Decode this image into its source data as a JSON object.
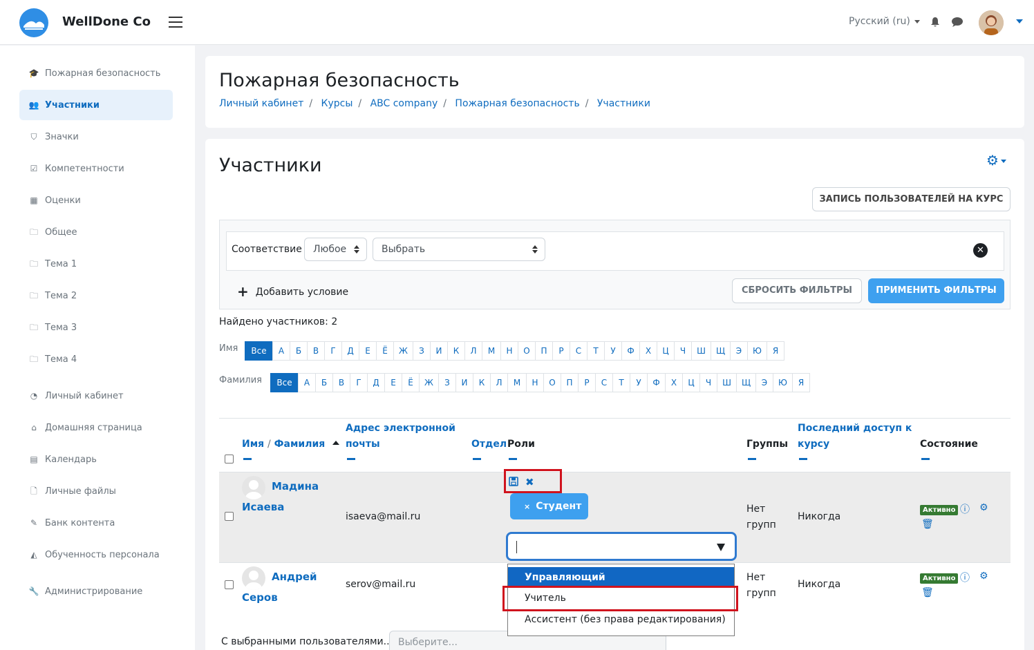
{
  "header": {
    "brand": "WellDone Co",
    "language": "Русский ‎(ru)‎"
  },
  "sidebar": {
    "items": [
      {
        "label": "Пожарная безопасность",
        "icon": "graduation-cap-icon"
      },
      {
        "label": "Участники",
        "icon": "users-icon",
        "active": true
      },
      {
        "label": "Значки",
        "icon": "shield-icon"
      },
      {
        "label": "Компетентности",
        "icon": "check-square-icon"
      },
      {
        "label": "Оценки",
        "icon": "table-icon"
      },
      {
        "label": "Общее",
        "icon": "folder-icon"
      },
      {
        "label": "Тема 1",
        "icon": "folder-icon"
      },
      {
        "label": "Тема 2",
        "icon": "folder-icon"
      },
      {
        "label": "Тема 3",
        "icon": "folder-icon"
      },
      {
        "label": "Тема 4",
        "icon": "folder-icon"
      },
      {
        "label": "Личный кабинет",
        "icon": "dashboard-icon"
      },
      {
        "label": "Домашняя страница",
        "icon": "home-icon"
      },
      {
        "label": "Календарь",
        "icon": "calendar-icon"
      },
      {
        "label": "Личные файлы",
        "icon": "file-icon"
      },
      {
        "label": "Банк контента",
        "icon": "brush-icon"
      },
      {
        "label": "Обученность персонала",
        "icon": "area-chart-icon"
      },
      {
        "label": "Администрирование",
        "icon": "wrench-icon"
      }
    ]
  },
  "page": {
    "heading": "Пожарная безопасность",
    "breadcrumb": [
      "Личный кабинет",
      "Курсы",
      "ABC company",
      "Пожарная безопасность",
      "Участники"
    ]
  },
  "participants": {
    "title": "Участники",
    "enrol_button": "ЗАПИСЬ ПОЛЬЗОВАТЕЛЕЙ НА КУРС",
    "filter": {
      "match_label": "Соответствие",
      "match_value": "Любое",
      "type_value": "Выбрать",
      "add_condition": "Добавить условие",
      "reset": "СБРОСИТЬ ФИЛЬТРЫ",
      "apply": "ПРИМЕНИТЬ ФИЛЬТРЫ"
    },
    "found": "Найдено участников: 2",
    "firstname_label": "Имя",
    "lastname_label": "Фамилия",
    "all_label": "Все",
    "letters": [
      "А",
      "Б",
      "В",
      "Г",
      "Д",
      "Е",
      "Ё",
      "Ж",
      "З",
      "И",
      "К",
      "Л",
      "М",
      "Н",
      "О",
      "П",
      "Р",
      "С",
      "Т",
      "У",
      "Ф",
      "Х",
      "Ц",
      "Ч",
      "Ш",
      "Щ",
      "Э",
      "Ю",
      "Я"
    ],
    "columns": {
      "name_first": "Имя",
      "name_sep": "/",
      "name_last": "Фамилия",
      "email_line1": "Адрес электронной",
      "email_line2": "почты",
      "dept": "Отдел",
      "roles": "Роли",
      "groups": "Группы",
      "access_line1": "Последний доступ к",
      "access_line2": "курсу",
      "status": "Состояние"
    },
    "rows": [
      {
        "first": "Мадина",
        "last": "Исаева",
        "email": "isaeva@mail.ru",
        "groups_line1": "Нет",
        "groups_line2": "групп",
        "access": "Никогда",
        "status": "Активно"
      },
      {
        "first": "Андрей",
        "last": "Серов",
        "email": "serov@mail.ru",
        "groups_line1": "Нет",
        "groups_line2": "групп",
        "access": "Никогда",
        "status": "Активно"
      }
    ],
    "role_edit": {
      "current_role": "Студент",
      "options": [
        "Управляющий",
        "Учитель",
        "Ассистент (без права редактирования)"
      ],
      "highlight_color": "#d0131d"
    },
    "bulk": {
      "label": "С выбранными пользователями...",
      "placeholder": "Выберите..."
    }
  },
  "colors": {
    "accent": "#0f6cbf",
    "button_primary": "#3ea0ef",
    "status_active": "#357a32"
  }
}
